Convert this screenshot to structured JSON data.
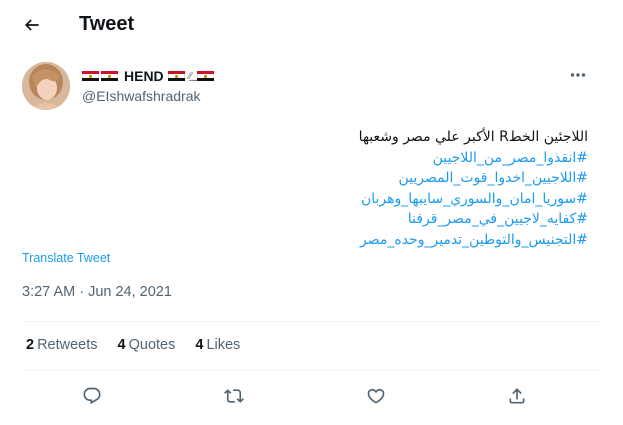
{
  "header": {
    "title": "Tweet"
  },
  "author": {
    "name": "HEND",
    "handle": "@EIshwafshradrak"
  },
  "tweet": {
    "lines": [
      "اللاجئين الخطR الأكبر علي مصر وشعبها"
    ],
    "hashtags": [
      "#انقذوا_مصر_من_اللاجيين",
      "#اللاجيين_اخدوا_قوت_المصريين",
      "#سوريا_امان_والسوري_سايبها_وهربان",
      "#كفايه_لاجيين_في_مصر_قرفنا",
      "#التجنيس_والتوطين_تدمير_وحده_مصر"
    ]
  },
  "translate_label": "Translate Tweet",
  "timestamp": "3:27 AM · Jun 24, 2021",
  "stats": {
    "retweets": {
      "count": "2",
      "label": "Retweets"
    },
    "quotes": {
      "count": "4",
      "label": "Quotes"
    },
    "likes": {
      "count": "4",
      "label": "Likes"
    }
  },
  "icons": {
    "back": "arrow-left-icon",
    "more": "more-horizontal-icon",
    "reply": "reply-icon",
    "retweet": "retweet-icon",
    "like": "heart-icon",
    "share": "share-icon"
  },
  "colors": {
    "link": "#1d9bf0",
    "muted": "#536471",
    "text": "#0f1419"
  }
}
